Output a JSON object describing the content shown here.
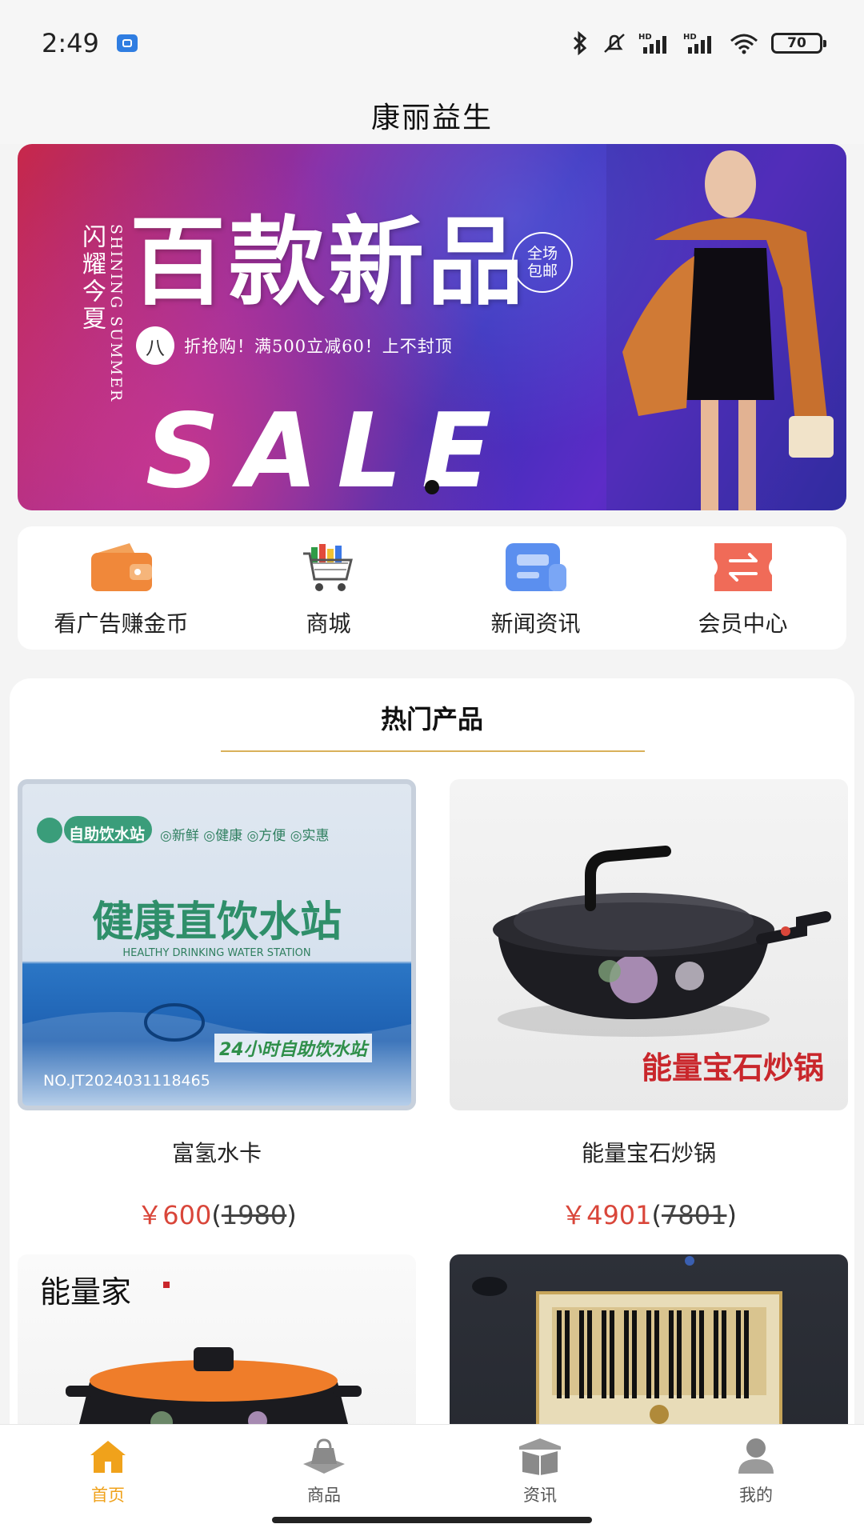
{
  "status_bar": {
    "time": "2:49",
    "battery": "70"
  },
  "header": {
    "title": "康丽益生"
  },
  "banner": {
    "vertical_text": "闪耀今夏",
    "english_text": "SHINING SUMMER",
    "headline": "百款新品",
    "badge": "全场包邮",
    "circle_char": "八",
    "promo": "折抢购！满500立减60！上不封顶",
    "sale": "SALE",
    "colors": {
      "start": "#c8284a",
      "end": "#2a2a9f"
    }
  },
  "quick_nav": [
    {
      "label": "看广告赚金币",
      "icon": "wallet-icon"
    },
    {
      "label": "商城",
      "icon": "shopping-cart-icon"
    },
    {
      "label": "新闻资讯",
      "icon": "news-icon"
    },
    {
      "label": "会员中心",
      "icon": "ticket-icon"
    }
  ],
  "hot_products": {
    "title": "热门产品",
    "items": [
      {
        "name": "富氢水卡",
        "price_symbol": "￥",
        "price": "600",
        "original_price": "1980",
        "image_text": {
          "badge": "自助饮水站",
          "tags": "◎新鲜 ◎健康 ◎方便 ◎实惠",
          "main": "健康直饮水站",
          "english": "HEALTHY DRINKING WATER STATION",
          "hours": "24小时自助饮水站",
          "serial": "NO.JT2024031118465"
        }
      },
      {
        "name": "能量宝石炒锅",
        "price_symbol": "￥",
        "price": "4901",
        "original_price": "7801",
        "image_text": {
          "caption": "能量宝石炒锅"
        }
      },
      {
        "name": "",
        "image_text": {
          "brand": "能量家"
        }
      },
      {
        "name": "",
        "image_text": {}
      }
    ]
  },
  "tab_bar": [
    {
      "label": "首页",
      "icon": "home-icon",
      "active": true
    },
    {
      "label": "商品",
      "icon": "shopping-bag-icon",
      "active": false
    },
    {
      "label": "资讯",
      "icon": "book-icon",
      "active": false
    },
    {
      "label": "我的",
      "icon": "user-icon",
      "active": false
    }
  ],
  "accent_color": "#f0a21b",
  "price_color": "#d9463a"
}
